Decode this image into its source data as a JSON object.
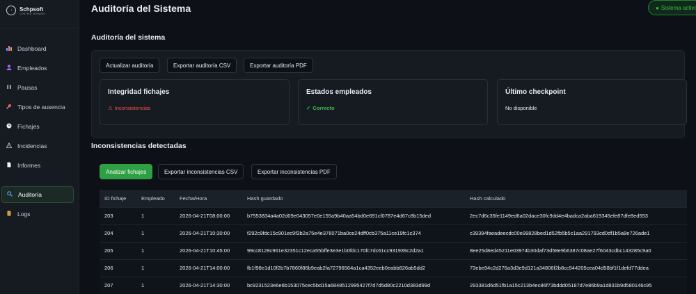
{
  "brand": {
    "name": "Schpsoft",
    "subtitle": "CONTROL HORARIO"
  },
  "sidebar": {
    "items": [
      {
        "label": "Dashboard",
        "icon": "bar-chart-icon"
      },
      {
        "label": "Empleados",
        "icon": "person-icon"
      },
      {
        "label": "Pausas",
        "icon": "pause-icon"
      },
      {
        "label": "Tipos de ausencia",
        "icon": "pin-icon"
      },
      {
        "label": "Fichajes",
        "icon": "clock-icon"
      },
      {
        "label": "Incidencias",
        "icon": "warning-icon"
      },
      {
        "label": "Informes",
        "icon": "document-icon"
      },
      {
        "label": "Auditoría",
        "icon": "search-icon",
        "active": true
      },
      {
        "label": "Logs",
        "icon": "scroll-icon"
      }
    ]
  },
  "header": {
    "title": "Auditoría del Sistema",
    "status": "Sistema activo"
  },
  "audit": {
    "title": "Auditoría del sistema",
    "buttons": [
      "Actualizar auditoría",
      "Exportar auditoría CSV",
      "Exportar auditoría PDF"
    ],
    "cards": [
      {
        "title": "Integridad fichajes",
        "value": "Inconsistencias",
        "icon": "warning-icon",
        "color": "#f85149"
      },
      {
        "title": "Estados empleados",
        "value": "Correcto",
        "icon": "check-icon",
        "color": "#3fb950"
      },
      {
        "title": "Último checkpoint",
        "value": "No disponible",
        "icon": "",
        "color": "#e6edf3"
      }
    ]
  },
  "inconsistencies": {
    "title": "Inconsistencias detectadas",
    "buttons": [
      "Analizar fichajes",
      "Exportar inconsistencias CSV",
      "Exportar inconsistencias PDF"
    ],
    "columns": [
      "ID fichaje",
      "Empleado",
      "Fecha/Hora",
      "Hash guardado",
      "Hash calculado"
    ],
    "rows": [
      [
        "203",
        "1",
        "2026-04-21T08:00:00",
        "b7553834a4a02d09e043057e0e155a9b40aa54bd0e691cf0787e4d67c8b15ded",
        "2ec7d6c35fe1149ed6a02dace30fc9dd4e4badca2aba619345efe87dfe8ed553"
      ],
      [
        "204",
        "1",
        "2026-04-21T10:30:00",
        "f292c9fdc15c901ec9f3b2a75e4e376071ba0ce24dff0cb375a11ce19fc1c374",
        "c39394faeadeecdc00e99828bed1d52fb5b5c1aa291793cd0df1b5a8e726ade1"
      ],
      [
        "205",
        "1",
        "2026-04-21T10:45:00",
        "99cc8128c961e32351c12eca55bffe3e3e1b0fdc170fc7dc61cc931939c2d2a1",
        "8ee25d8ed45211e03974b30daf73d58e9b6387c08ae27f6043cdbc143285c9a0"
      ],
      [
        "206",
        "1",
        "2026-04-21T14:00:00",
        "fb1f98e1d10f2b7b7860f86b9eab2fa72796564a1ca4352eeb0eabb826ab5dd2",
        "73ebe94c2d276a3d3e9d121a34806f2b8cc544205cea04d58bf1f1defd77ddea"
      ],
      [
        "207",
        "1",
        "2026-04-21T14:30:00",
        "bc9231523e6e6b153075cec5bd15a6848512995427f7d7d5d80c2210d383d99d",
        "293381d6d51fb1a15c213b4ec86f73bddd05187d7e86b9a1d831b9d580146c95"
      ]
    ]
  }
}
